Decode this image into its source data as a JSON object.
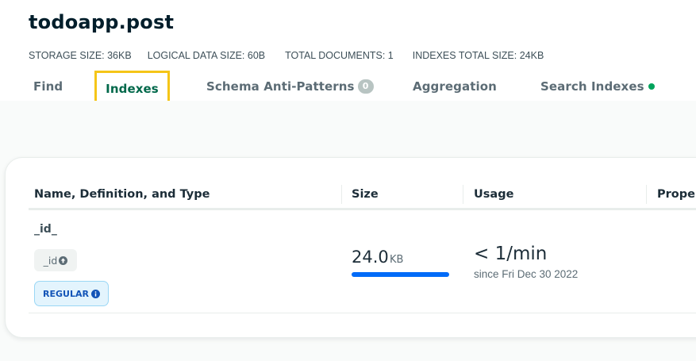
{
  "collection": {
    "title": "todoapp.post"
  },
  "stats": {
    "storage_size": "STORAGE SIZE: 36KB",
    "logical_data_size": "LOGICAL DATA SIZE: 60B",
    "total_documents": "TOTAL DOCUMENTS: 1",
    "indexes_total_size": "INDEXES TOTAL SIZE: 24KB"
  },
  "tabs": [
    {
      "label": "Find"
    },
    {
      "label": "Indexes",
      "selected": true
    },
    {
      "label": "Schema Anti-Patterns",
      "badge": "0"
    },
    {
      "label": "Aggregation"
    },
    {
      "label": "Search Indexes",
      "status_dot_color": "#00a35c"
    }
  ],
  "table": {
    "columns": [
      "Name, Definition, and Type",
      "Size",
      "Usage",
      "Proper"
    ],
    "rows": [
      {
        "name": "_id_",
        "key": "_id",
        "type": "REGULAR",
        "size_value": "24.0",
        "size_unit": "KB",
        "size_fraction": 1.0,
        "usage": "< 1/min",
        "since": "since Fri Dec 30 2022"
      }
    ]
  },
  "colors": {
    "accent_green": "#00684a",
    "highlight_box": "#f5c518",
    "size_bar": "#016bf8",
    "badge_blue": "#1254b7"
  },
  "icons": {
    "key_direction": "arrow-up-circle-icon",
    "type_info": "info-icon"
  }
}
